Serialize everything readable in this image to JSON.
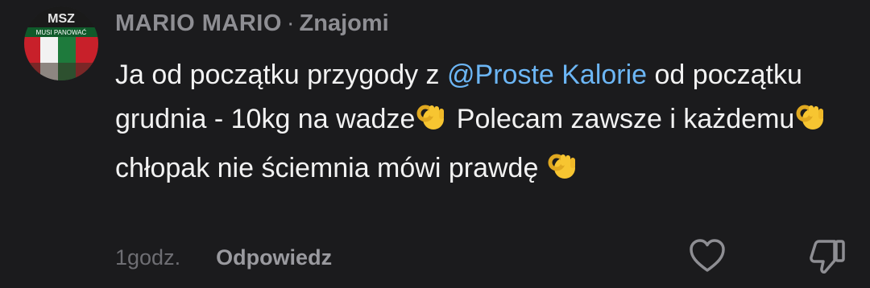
{
  "comment": {
    "author": "MARIO MARIO",
    "separator": "·",
    "relation": "Znajomi",
    "avatar_text_top": "MSZ",
    "avatar_text_banner": "MUSI PANOWAĆ",
    "text_parts": [
      "Ja od początku przygody z ",
      "@Proste Kalorie",
      " od początku grudnia - 10kg na wadze",
      " Polecam zawsze i każdemu",
      " chłopak nie ściemnia mówi prawdę "
    ],
    "emoji_icon": "ok-hand-emoji",
    "time": "1godz.",
    "reply_label": "Odpowiedz"
  },
  "colors": {
    "background": "#1b1b1d",
    "mention": "#6cb6f5",
    "muted": "#8e8e93"
  }
}
